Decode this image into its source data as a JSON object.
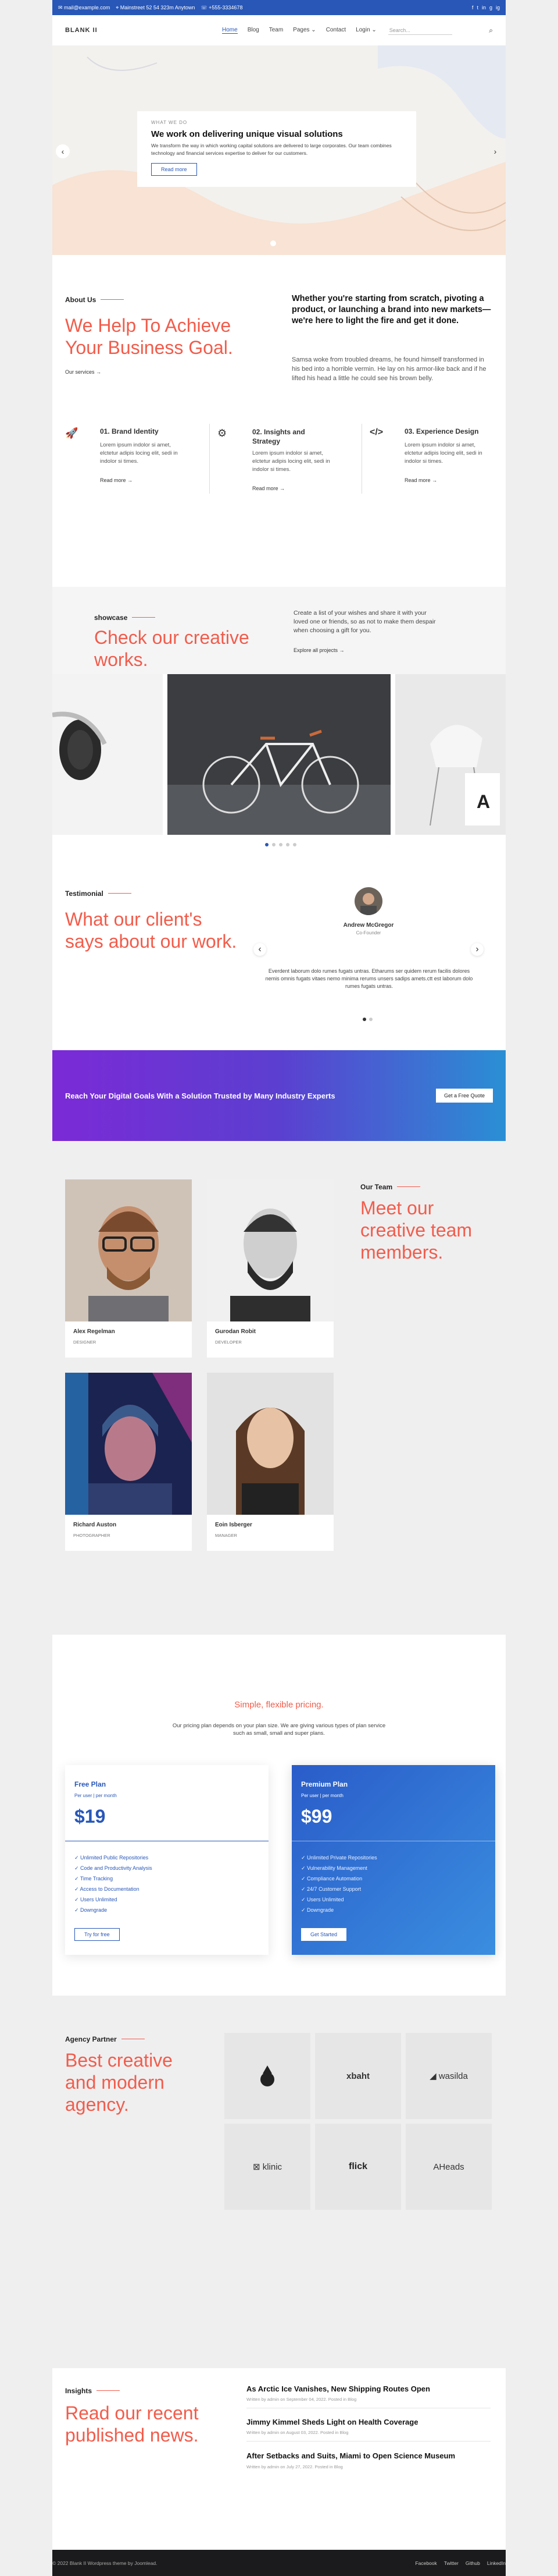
{
  "topbar": {
    "email": "mail@example.com",
    "address": "Mainstreet 52 54 323m Anytown",
    "phone": "+555-3334678",
    "social": [
      "f",
      "t",
      "in",
      "g",
      "ig"
    ]
  },
  "nav": {
    "logo": "BLANK II",
    "items": [
      "Home",
      "Blog",
      "Team",
      "Pages",
      "Contact",
      "Login"
    ],
    "search_placeholder": "Search..."
  },
  "hero": {
    "eyebrow": "WHAT WE DO",
    "title": "We work on delivering unique visual solutions",
    "text": "We transform the way in which working capital solutions are delivered to large corporates. Our team combines technology and financial services expertise to deliver for our customers.",
    "button": "Read more",
    "prev": "‹",
    "next": "›"
  },
  "about": {
    "label": "About Us",
    "title": "We Help To Achieve Your Business Goal.",
    "link": "Our services",
    "heading": "Whether you're starting from scratch, pivoting a product, or launching a brand into new markets—we're here to light the fire and get it done.",
    "text": "Samsa woke from troubled dreams, he found himself transformed in his bed into a horrible vermin. He lay on his armor-like back and if he lifted his head a little he could see his brown belly.",
    "features": [
      {
        "icon": "rocket-icon",
        "title": "01. Brand Identity",
        "text": "Lorem ipsum indolor si amet, elctetur adipis locing elit, sedi in indolor si times.",
        "link": "Read more"
      },
      {
        "icon": "gear-icon",
        "title": "02. Insights and Strategy",
        "text": "Lorem ipsum indolor si amet, elctetur adipis locing elit, sedi in indolor si times.",
        "link": "Read more"
      },
      {
        "icon": "code-icon",
        "title": "03. Experience Design",
        "text": "Lorem ipsum indolor si amet, elctetur adipis locing elit, sedi in indolor si times.",
        "link": "Read more"
      }
    ]
  },
  "showcase": {
    "label": "showcase",
    "title": "Check our creative works.",
    "text": "Create a list of your wishes and share it with your loved one or friends, so as not to make them despair when choosing a gift for you.",
    "link": "Explore all projects"
  },
  "testimonial": {
    "label": "Testimonial",
    "title": "What our client's says about our work.",
    "name": "Andrew McGregor",
    "role": "Co-Founder",
    "quote": "Everdent laborum dolo rumes fugats untras. Etharums ser quidem rerum facilis dolores nemis omnis fugats vitaes nemo minima rerums unsers sadips amets.ctt est laborum dolo rumes fugats untras.",
    "prev": "‹",
    "next": "›"
  },
  "cta": {
    "text": "Reach Your Digital Goals With a Solution Trusted by Many Industry Experts",
    "button": "Get a Free Quote"
  },
  "team": {
    "label": "Our Team",
    "title": "Meet our creative team members.",
    "members": [
      {
        "name": "Alex Regelman",
        "role": "DESIGNER"
      },
      {
        "name": "Gurodan Robit",
        "role": "DEVELOPER"
      },
      {
        "name": "Richard Auston",
        "role": "PHOTOGRAPHER"
      },
      {
        "name": "Eoin Isberger",
        "role": "MANAGER"
      }
    ]
  },
  "pricing": {
    "title": "Simple, flexible pricing.",
    "text": "Our pricing plan depends on your plan size. We are giving various types of plan service such as small, small and super plans.",
    "free": {
      "name": "Free Plan",
      "sub": "Per user | per month",
      "price": "$19",
      "features": [
        "Unlimited Public Repositories",
        "Code and Productivity Analysis",
        "Time Tracking",
        "Access to Documentation",
        "Users Unlimited",
        "Downgrade"
      ],
      "button": "Try for free"
    },
    "premium": {
      "name": "Premium Plan",
      "sub": "Per user | per month",
      "price": "$99",
      "features": [
        "Unlimited Private Repositories",
        "Vulnerability Management",
        "Compliance Automation",
        "24/7 Customer Support",
        "Users Unlimited",
        "Downgrade"
      ],
      "button": "Get Started"
    }
  },
  "agency": {
    "label": "Agency Partner",
    "title": "Best creative and modern agency.",
    "logos": [
      "",
      "xbaht",
      "wasilda",
      "klinic",
      "flick",
      "AHeads"
    ]
  },
  "insights": {
    "label": "Insights",
    "title": "Read our recent published news.",
    "posts": [
      {
        "title": "As Arctic Ice Vanishes, New Shipping Routes Open",
        "meta": "Written by admin on September 04, 2022. Posted in Blog"
      },
      {
        "title": "Jimmy Kimmel Sheds Light on Health Coverage",
        "meta": "Written by admin on August 03, 2022. Posted in Blog"
      },
      {
        "title": "After Setbacks and Suits, Miami to Open Science Museum",
        "meta": "Written by admin on July 27, 2022. Posted in Blog"
      }
    ]
  },
  "footer": {
    "copyright": "© 2022 Blank II Wordpress theme by Joomlead.",
    "links": [
      "Facebook",
      "Twitter",
      "Github",
      "LinkedIn"
    ]
  }
}
